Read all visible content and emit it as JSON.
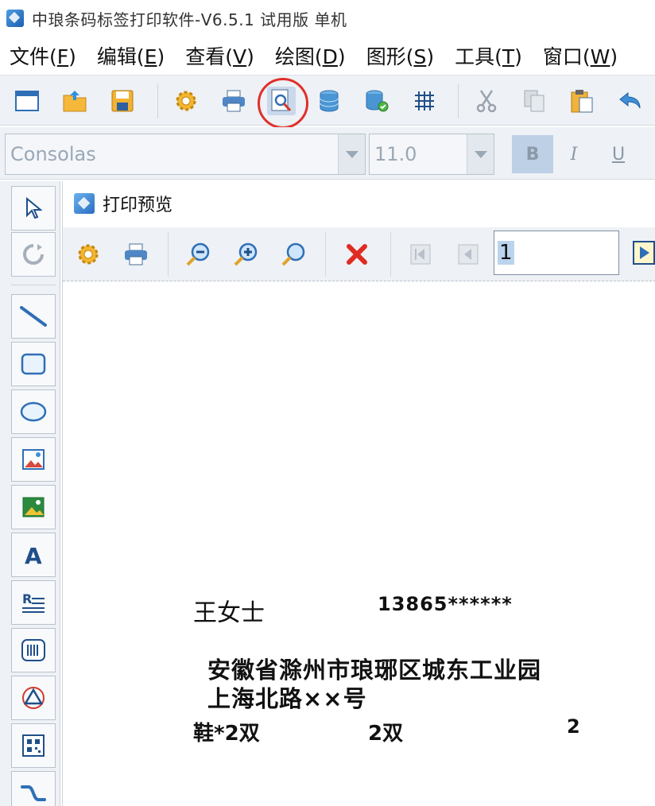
{
  "window": {
    "title": "中琅条码标签打印软件-V6.5.1 试用版 单机"
  },
  "menu": [
    {
      "label": "文件(",
      "key": "F",
      "suffix": ")"
    },
    {
      "label": "编辑(",
      "key": "E",
      "suffix": ")"
    },
    {
      "label": "查看(",
      "key": "V",
      "suffix": ")"
    },
    {
      "label": "绘图(",
      "key": "D",
      "suffix": ")"
    },
    {
      "label": "图形(",
      "key": "S",
      "suffix": ")"
    },
    {
      "label": "工具(",
      "key": "T",
      "suffix": ")"
    },
    {
      "label": "窗口(",
      "key": "W",
      "suffix": ")"
    }
  ],
  "toolbar": {
    "icons": [
      "new-icon",
      "open-icon",
      "save-icon",
      "settings-icon",
      "print-icon",
      "print-preview-icon",
      "database-icon",
      "database-connect-icon",
      "grid-icon",
      "cut-icon",
      "copy-icon",
      "paste-icon",
      "undo-icon"
    ],
    "highlighted": "print-preview-icon",
    "highlight_color": "#e0302a"
  },
  "font": {
    "family": "Consolas",
    "size": "11.0",
    "bold": "B",
    "italic": "I",
    "underline": "U"
  },
  "toolbox": {
    "icons": [
      "select-arrow-icon",
      "rotate-icon",
      "line-icon",
      "rectangle-icon",
      "ellipse-icon",
      "image-icon",
      "picture-icon",
      "text-icon",
      "rich-text-icon",
      "barcode-icon",
      "shape-icon",
      "qrcode-icon",
      "curve-icon"
    ]
  },
  "preview": {
    "title": "打印预览",
    "page_number": "1",
    "label": {
      "name": "王女士",
      "phone": "13865******",
      "address_line1": "安徽省滁州市琅琊区城东工业园",
      "address_line2": "上海北路××号",
      "item": "鞋*2双",
      "quantity": "2双",
      "total": "2"
    }
  }
}
